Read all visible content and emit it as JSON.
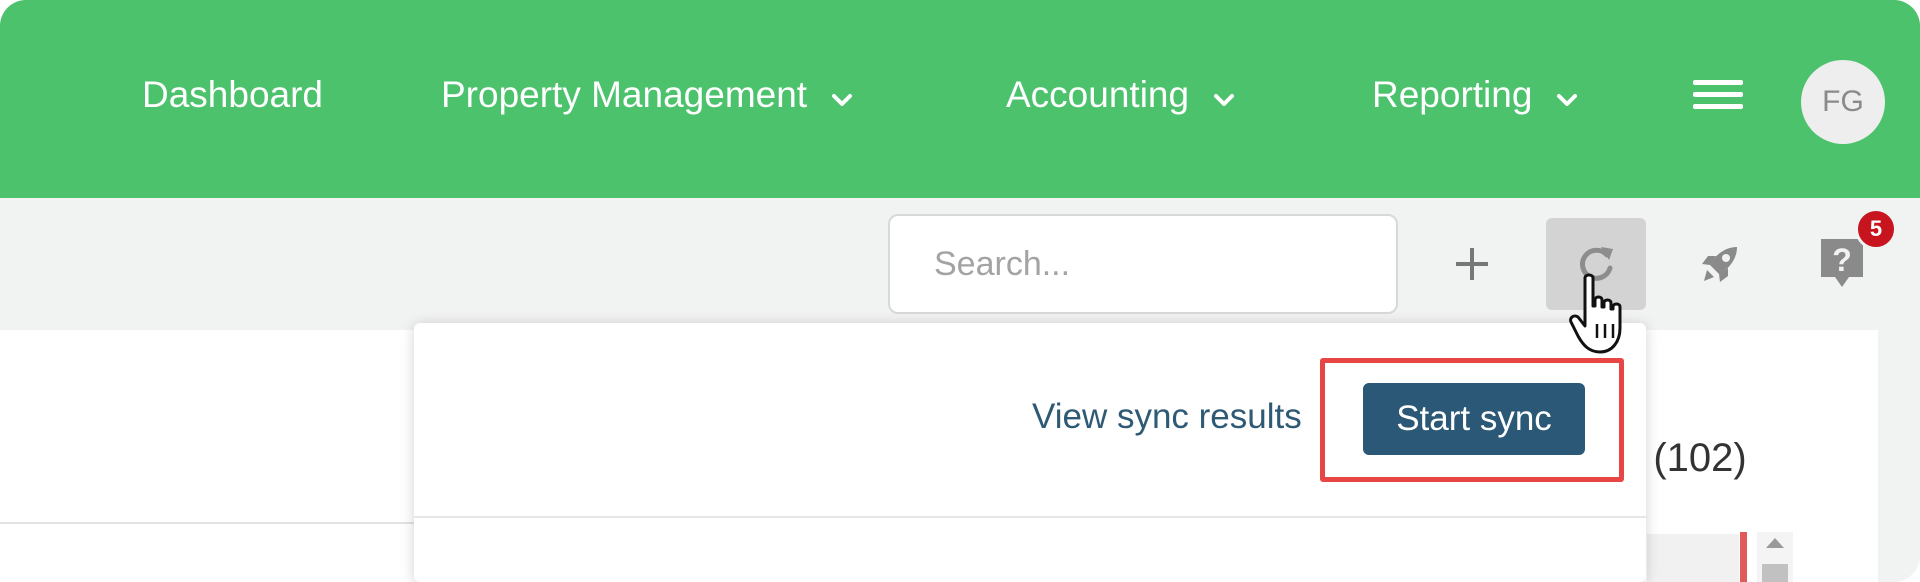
{
  "nav": {
    "items": [
      {
        "label": "Dashboard",
        "has_chevron": false
      },
      {
        "label": "Property Management",
        "has_chevron": true
      },
      {
        "label": "Accounting",
        "has_chevron": true
      },
      {
        "label": "Reporting",
        "has_chevron": true
      }
    ],
    "menu_icon": "hamburger-icon",
    "avatar_initials": "FG"
  },
  "toolbar": {
    "search_placeholder": "Search...",
    "add_icon": "plus-icon",
    "sync_icon": "sync-icon",
    "rocket_icon": "rocket-icon",
    "help_icon": "help-icon",
    "help_badge_count": "5"
  },
  "sync_dropdown": {
    "view_results_label": "View sync results",
    "start_sync_label": "Start sync"
  },
  "background": {
    "partial_heading": "e (102)"
  },
  "colors": {
    "nav_bg": "#4dc26d",
    "primary_button": "#2b5876",
    "badge": "#c8141e",
    "highlight_box": "#e84545"
  }
}
